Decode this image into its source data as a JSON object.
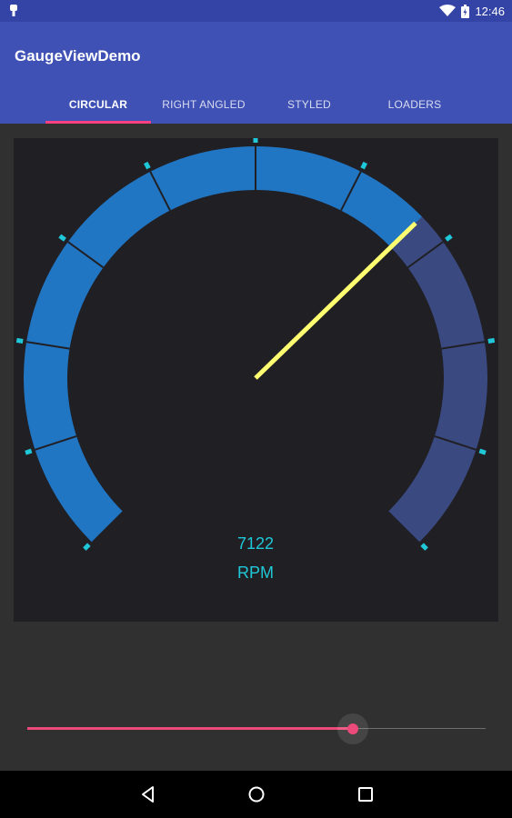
{
  "status_bar": {
    "time": "12:46",
    "icons": [
      "notification-icon",
      "wifi-icon",
      "battery-icon"
    ]
  },
  "app_bar": {
    "title": "GaugeViewDemo",
    "tabs": [
      {
        "label": "CIRCULAR",
        "active": true
      },
      {
        "label": "RIGHT ANGLED",
        "active": false
      },
      {
        "label": "STYLED",
        "active": false
      },
      {
        "label": "LOADERS",
        "active": false
      }
    ]
  },
  "gauge": {
    "value": "7122",
    "unit": "RPM",
    "fraction": 0.67,
    "colors": {
      "active_arc": "#2176c4",
      "inactive_arc": "#3a4a80",
      "needle": "#fffd70",
      "tick": "#1fc8d8",
      "text": "#1fc8d8",
      "background": "#201f24"
    }
  },
  "slider": {
    "fraction": 0.71,
    "color": "#ec4a7a"
  },
  "nav_bar": {
    "buttons": [
      "back-icon",
      "home-icon",
      "recents-icon"
    ]
  }
}
